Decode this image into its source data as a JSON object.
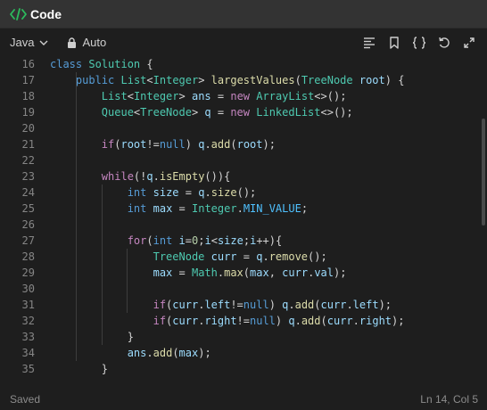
{
  "titlebar": {
    "title": "Code",
    "icon": "code-brackets-icon",
    "accent": "#2cbb5d"
  },
  "toolbar": {
    "language": "Java",
    "mode": "Auto",
    "icons": [
      "format-icon",
      "bookmark-icon",
      "braces-icon",
      "reset-icon",
      "expand-icon"
    ]
  },
  "editor": {
    "lines": [
      {
        "n": "16",
        "code": "class Solution {"
      },
      {
        "n": "17",
        "code": "    public List<Integer> largestValues(TreeNode root) {"
      },
      {
        "n": "18",
        "code": "        List<Integer> ans = new ArrayList<>();"
      },
      {
        "n": "19",
        "code": "        Queue<TreeNode> q = new LinkedList<>();"
      },
      {
        "n": "20",
        "code": ""
      },
      {
        "n": "21",
        "code": "        if(root!=null) q.add(root);"
      },
      {
        "n": "22",
        "code": ""
      },
      {
        "n": "23",
        "code": "        while(!q.isEmpty()){"
      },
      {
        "n": "24",
        "code": "            int size = q.size();"
      },
      {
        "n": "25",
        "code": "            int max = Integer.MIN_VALUE;"
      },
      {
        "n": "26",
        "code": ""
      },
      {
        "n": "27",
        "code": "            for(int i=0;i<size;i++){"
      },
      {
        "n": "28",
        "code": "                TreeNode curr = q.remove();"
      },
      {
        "n": "29",
        "code": "                max = Math.max(max, curr.val);"
      },
      {
        "n": "30",
        "code": ""
      },
      {
        "n": "31",
        "code": "                if(curr.left!=null) q.add(curr.left);"
      },
      {
        "n": "32",
        "code": "                if(curr.right!=null) q.add(curr.right);"
      },
      {
        "n": "33",
        "code": "            }"
      },
      {
        "n": "34",
        "code": "            ans.add(max);"
      },
      {
        "n": "35",
        "code": "        }"
      }
    ]
  },
  "status": {
    "left": "Saved",
    "right": "Ln 14, Col 5"
  }
}
